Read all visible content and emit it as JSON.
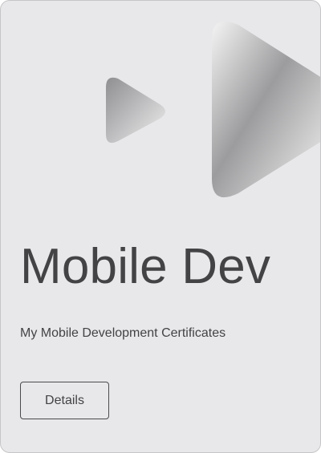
{
  "card": {
    "title": "Mobile Dev",
    "subtitle": "My Mobile Development Certificates",
    "details_label": "Details",
    "icon": "play-icon"
  },
  "colors": {
    "card_background": "#e8e8ea",
    "text": "#434345",
    "button_border": "#4b4b4d"
  }
}
